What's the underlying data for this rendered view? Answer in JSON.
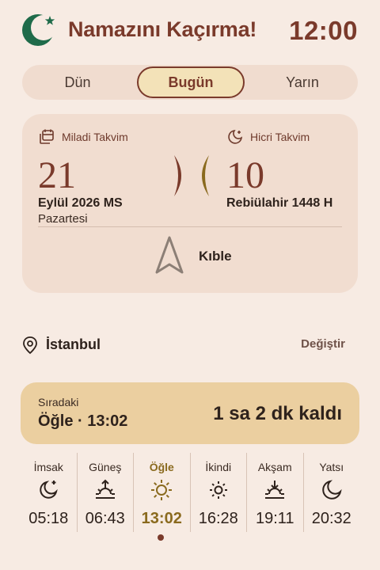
{
  "header": {
    "title": "Namazını Kaçırma!",
    "clock": "12:00"
  },
  "tabs": [
    {
      "label": "Dün",
      "active": false
    },
    {
      "label": "Bugün",
      "active": true
    },
    {
      "label": "Yarın",
      "active": false
    }
  ],
  "calendar": {
    "gregorian": {
      "label": "Miladi Takvim",
      "day": "21",
      "month_year": "Eylül 2026 MS",
      "weekday": "Pazartesi"
    },
    "hijri": {
      "label": "Hicri Takvim",
      "day": "10",
      "month_year": "Rebiülahir 1448 H"
    },
    "qibla_label": "Kıble"
  },
  "location": {
    "name": "İstanbul",
    "change_label": "Değiştir"
  },
  "next_prayer": {
    "label": "Sıradaki",
    "name_time": "Öğle · 13:02",
    "remaining": "1 sa 2 dk kaldı"
  },
  "prayers": [
    {
      "name": "İmsak",
      "time": "05:18",
      "icon": "moon-star-icon",
      "current": false
    },
    {
      "name": "Güneş",
      "time": "06:43",
      "icon": "sunrise-icon",
      "current": false
    },
    {
      "name": "Öğle",
      "time": "13:02",
      "icon": "sun-icon",
      "current": true
    },
    {
      "name": "İkindi",
      "time": "16:28",
      "icon": "sun-small-icon",
      "current": false
    },
    {
      "name": "Akşam",
      "time": "19:11",
      "icon": "sunset-icon",
      "current": false
    },
    {
      "name": "Yatsı",
      "time": "20:32",
      "icon": "moon-icon",
      "current": false
    }
  ],
  "colors": {
    "accent": "#7A3A2B",
    "background": "#F7EBE3",
    "card": "#F1DDD0",
    "highlight": "#EBCFA0",
    "current_prayer": "#8A6A1E",
    "logo_green": "#1F6B4A"
  }
}
